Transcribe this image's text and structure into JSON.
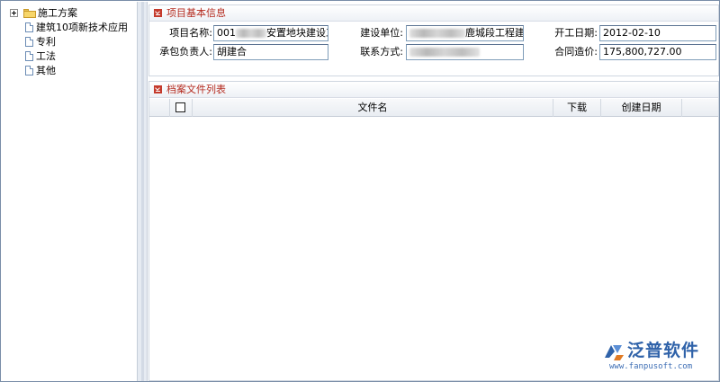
{
  "tree": {
    "items": [
      {
        "label": "施工方案",
        "icon": "folder-icon",
        "expandable": true
      },
      {
        "label": "建筑10项新技术应用",
        "icon": "document-icon"
      },
      {
        "label": "专利",
        "icon": "document-icon"
      },
      {
        "label": "工法",
        "icon": "document-icon"
      },
      {
        "label": "其他",
        "icon": "document-icon"
      }
    ]
  },
  "project_info": {
    "title": "项目基本信息",
    "fields": {
      "project_name": {
        "label": "项目名称:",
        "value_prefix": "001",
        "value_suffix": "安置地块建设工"
      },
      "construction_unit": {
        "label": "建设单位:",
        "value_suffix": "鹿城段工程建"
      },
      "start_date": {
        "label": "开工日期:",
        "value": "2012-02-10"
      },
      "manager": {
        "label": "承包负责人:",
        "value": "胡建合"
      },
      "contact": {
        "label": "联系方式:",
        "value": ""
      },
      "contract_price": {
        "label": "合同造价:",
        "value": "175,800,727.00"
      }
    }
  },
  "file_list": {
    "title": "档案文件列表",
    "columns": {
      "file_name": "文件名",
      "download": "下载",
      "created_date": "创建日期"
    },
    "rows": []
  },
  "watermark": {
    "brand": "泛普软件",
    "url": "www.fanpusoft.com"
  },
  "colors": {
    "accent_red": "#b42a1e",
    "icon_red": "#c43a2c",
    "border_blue": "#7f9db9",
    "brand_blue": "#2f62a9"
  }
}
